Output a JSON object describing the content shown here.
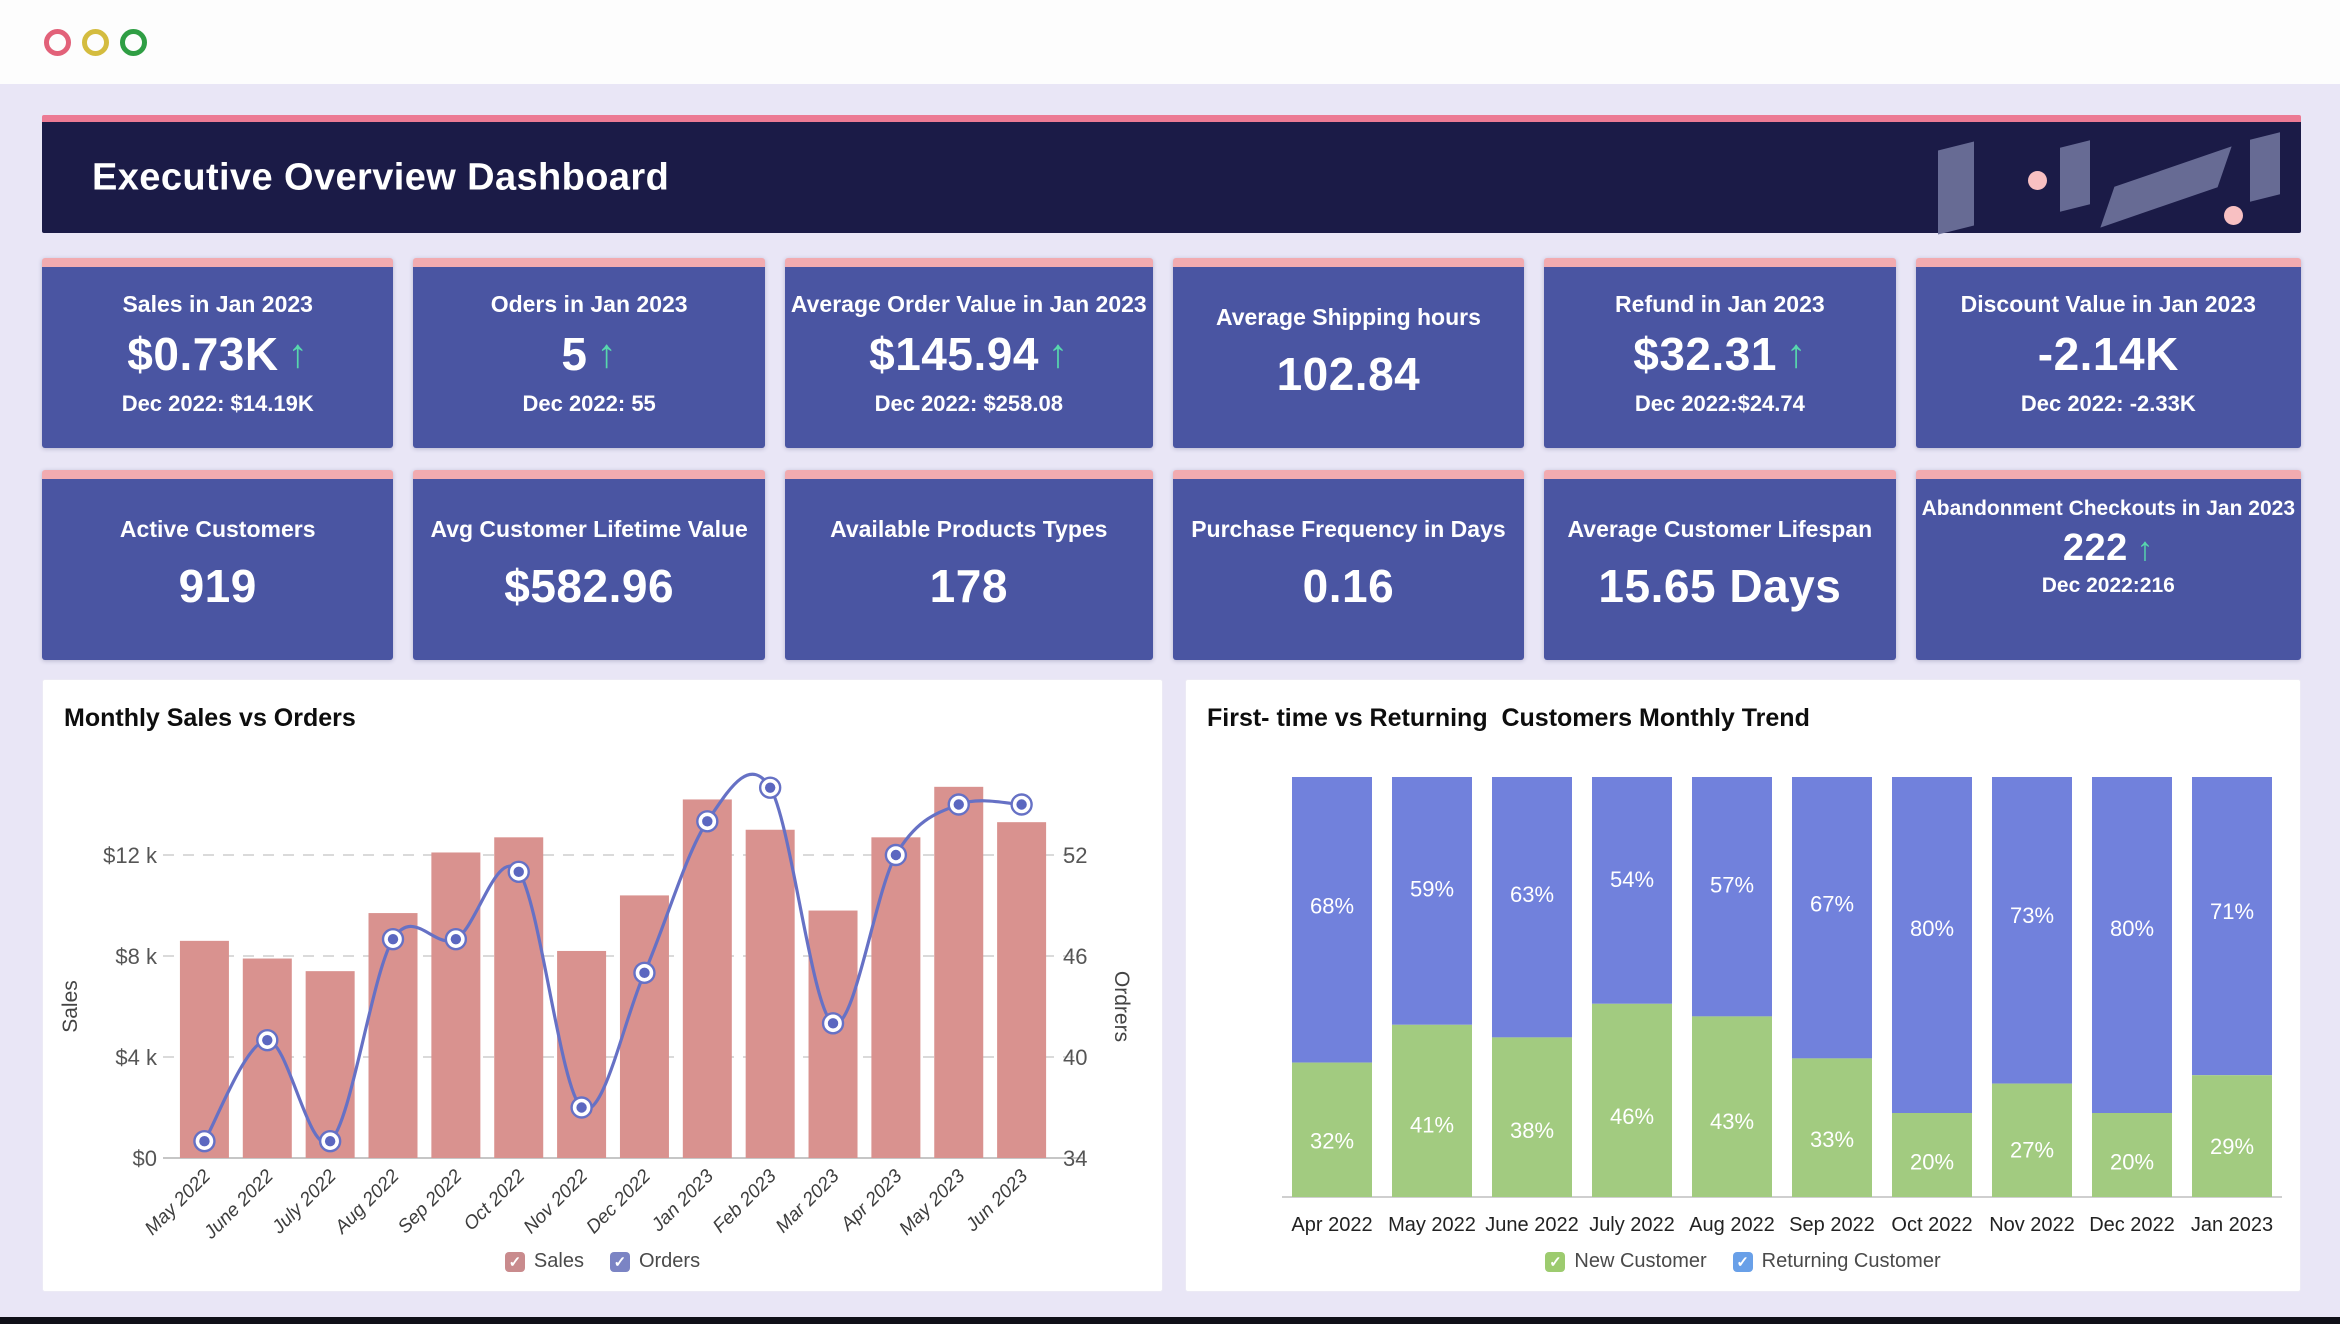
{
  "window": {
    "controls": [
      {
        "name": "close",
        "color": "#e26179"
      },
      {
        "name": "minimize",
        "color": "#d4bc3f"
      },
      {
        "name": "maximize",
        "color": "#2f9e44"
      }
    ]
  },
  "header": {
    "title": "Executive Overview Dashboard",
    "background": "#1b1b47",
    "accent_border": "#ec7a94"
  },
  "theme": {
    "page_background": "#e9e6f6",
    "topbar_background": "#fdfdfd",
    "kpi_card_background": "#4a55a2",
    "kpi_card_border": "#f2abb0",
    "kpi_arrow_up": "#57d7ad",
    "panel_background": "#ffffff"
  },
  "kpi_cards": [
    {
      "title": "Sales in Jan 2023",
      "value": "$0.73K",
      "arrow": "up",
      "sub": "Dec 2022: $14.19K"
    },
    {
      "title": "Oders in Jan 2023",
      "value": "5",
      "arrow": "up",
      "sub": "Dec 2022: 55"
    },
    {
      "title": "Average Order Value in Jan 2023",
      "value": "$145.94",
      "arrow": "up",
      "sub": "Dec 2022: $258.08"
    },
    {
      "title": "Average Shipping hours",
      "value": "102.84",
      "arrow": null,
      "sub": null
    },
    {
      "title": "Refund in Jan 2023",
      "value": "$32.31",
      "arrow": "up",
      "sub": "Dec 2022:$24.74"
    },
    {
      "title": "Discount Value in Jan 2023",
      "value": "-2.14K",
      "arrow": null,
      "sub": "Dec 2022:  -2.33K"
    },
    {
      "title": "Active Customers",
      "value": "919",
      "arrow": null,
      "sub": null
    },
    {
      "title": "Avg Customer Lifetime Value",
      "value": "$582.96",
      "arrow": null,
      "sub": null
    },
    {
      "title": "Available Products Types",
      "value": "178",
      "arrow": null,
      "sub": null
    },
    {
      "title": "Purchase Frequency in Days",
      "value": "0.16",
      "arrow": null,
      "sub": null
    },
    {
      "title": "Average Customer Lifespan",
      "value": "15.65 Days",
      "arrow": null,
      "sub": null
    },
    {
      "title": "Abandonment Checkouts in Jan 2023",
      "value": "222",
      "arrow": "up",
      "sub": "Dec 2022:216",
      "compact": true
    }
  ],
  "chart_data": [
    {
      "id": "monthly-sales-vs-orders",
      "type": "bar+line",
      "title": "Monthly Sales vs Orders",
      "categories": [
        "May 2022",
        "June 2022",
        "July 2022",
        "Aug 2022",
        "Sep 2022",
        "Oct 2022",
        "Nov 2022",
        "Dec 2022",
        "Jan 2023",
        "Feb 2023",
        "Mar 2023",
        "Apr 2023",
        "May 2023",
        "Jun 2023"
      ],
      "series": [
        {
          "name": "Sales",
          "type": "bar",
          "unit": "USD thousands",
          "color": "#d9928f",
          "values": [
            8.6,
            7.9,
            7.4,
            9.7,
            12.1,
            12.7,
            8.2,
            10.4,
            14.2,
            13.0,
            9.8,
            12.7,
            14.7,
            13.3
          ]
        },
        {
          "name": "Orders",
          "type": "line",
          "color": "#6671c5",
          "marker_fill": "#5b67c0",
          "values": [
            35,
            41,
            35,
            47,
            47,
            51,
            37,
            45,
            54,
            56,
            42,
            52,
            55,
            55
          ]
        }
      ],
      "y_left": {
        "label": "Sales",
        "range": [
          0,
          14.95
        ],
        "ticks": [
          {
            "v": 0,
            "t": "$0"
          },
          {
            "v": 4,
            "t": "$4 k"
          },
          {
            "v": 8,
            "t": "$8 k"
          },
          {
            "v": 12,
            "t": "$12 k"
          }
        ]
      },
      "y_right": {
        "label": "Ordrers",
        "range": [
          34,
          56.4
        ],
        "ticks": [
          {
            "v": 34,
            "t": "34"
          },
          {
            "v": 40,
            "t": "40"
          },
          {
            "v": 46,
            "t": "46"
          },
          {
            "v": 52,
            "t": "52"
          }
        ]
      },
      "grid": "dashed horizontal",
      "legend": [
        {
          "label": "Sales",
          "color": "#c98b8d",
          "check": "✓"
        },
        {
          "label": "Orders",
          "color": "#7b84c4",
          "check": "✓"
        }
      ]
    },
    {
      "id": "first-time-vs-returning",
      "type": "stacked_bar_percent",
      "title": "First- time vs Returning  Customers Monthly Trend",
      "categories": [
        "Apr 2022",
        "May 2022",
        "June 2022",
        "July 2022",
        "Aug 2022",
        "Sep 2022",
        "Oct 2022",
        "Nov 2022",
        "Dec 2022",
        "Jan 2023"
      ],
      "series": [
        {
          "name": "New Customer",
          "color": "#a2cb80",
          "values_pct": [
            32,
            41,
            38,
            46,
            43,
            33,
            20,
            27,
            20,
            29
          ]
        },
        {
          "name": "Returning Customer",
          "color": "#7181dc",
          "values_pct": [
            68,
            59,
            63,
            54,
            57,
            67,
            80,
            73,
            80,
            71
          ]
        }
      ],
      "legend": [
        {
          "label": "New Customer",
          "color": "#9dcb6f",
          "check": "✓"
        },
        {
          "label": "Returning Customer",
          "color": "#69a0e8",
          "check": "✓"
        }
      ]
    }
  ]
}
